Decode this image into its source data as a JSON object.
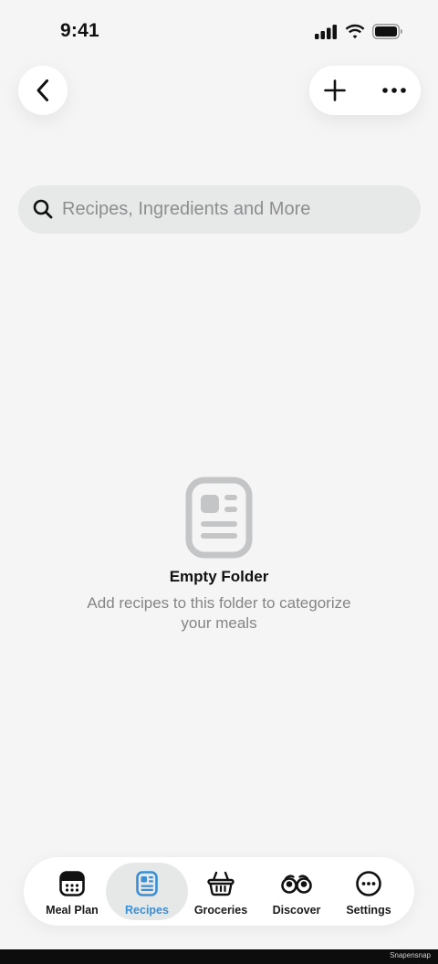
{
  "status_bar": {
    "time": "9:41",
    "icons": [
      "cellular-signal-icon",
      "wifi-icon",
      "battery-icon"
    ]
  },
  "nav": {
    "back_icon": "chevron-left-icon",
    "add_icon": "plus-icon",
    "more_icon": "ellipsis-icon"
  },
  "search": {
    "placeholder": "Recipes, Ingredients and More",
    "value": "",
    "icon": "search-icon"
  },
  "empty_state": {
    "icon": "recipe-card-icon",
    "title": "Empty Folder",
    "description": "Add recipes to this folder to categorize your meals"
  },
  "tabs": [
    {
      "label": "Meal Plan",
      "icon": "calendar-icon",
      "active": false
    },
    {
      "label": "Recipes",
      "icon": "recipe-card-icon",
      "active": true
    },
    {
      "label": "Groceries",
      "icon": "basket-icon",
      "active": false
    },
    {
      "label": "Discover",
      "icon": "binoculars-icon",
      "active": false
    },
    {
      "label": "Settings",
      "icon": "ellipsis-circle-icon",
      "active": false
    }
  ],
  "footer": {
    "credit": "Snapensnap"
  },
  "colors": {
    "background": "#f4f5f4",
    "accent": "#3a8fd4",
    "muted_text": "#858587",
    "active_tab_bg": "#e6e8e8"
  }
}
